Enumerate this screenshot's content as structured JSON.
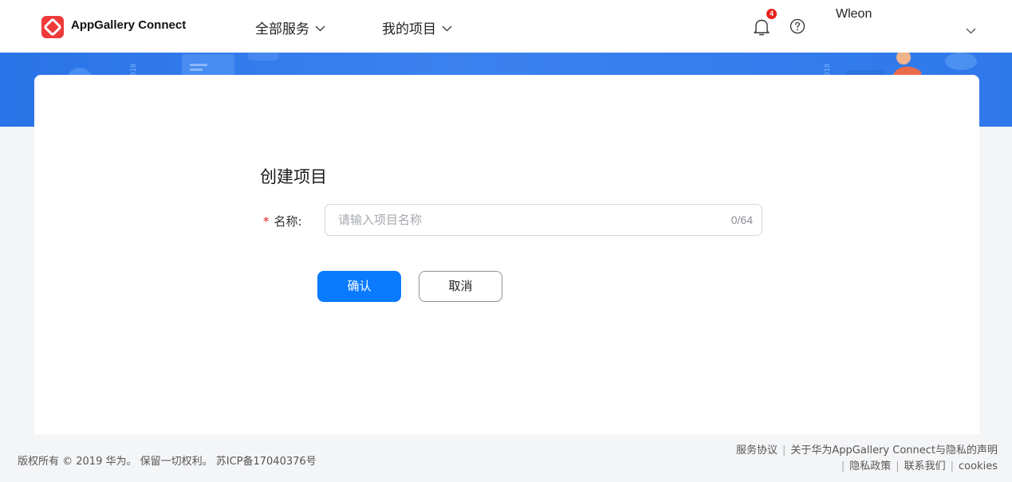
{
  "header": {
    "app_name": "AppGallery Connect",
    "nav": {
      "all_services": "全部服务",
      "my_projects": "我的项目"
    },
    "notification_count": "4",
    "user_name": "Wleon"
  },
  "form": {
    "title": "创建项目",
    "name_label": "名称:",
    "required_mark": "*",
    "name_placeholder": "请输入项目名称",
    "name_value": "",
    "char_counter": "0/64",
    "confirm_label": "确认",
    "cancel_label": "取消"
  },
  "footer": {
    "copyright": "版权所有 © 2019 华为。 保留一切权利。 苏ICP备17040376号",
    "links_row1": [
      "服务协议",
      "关于华为AppGallery Connect与隐私的声明"
    ],
    "links_row2": [
      "隐私政策",
      "联系我们",
      "cookies"
    ]
  },
  "colors": {
    "brand_red": "#ef3a3a",
    "primary_blue": "#0a7bff",
    "banner_blue": "#2f78eb",
    "badge_red": "#e8211d"
  },
  "icons": {
    "logo": "appgallery-logo-icon",
    "notification": "bell-icon",
    "help": "help-circle-icon",
    "dropdown": "chevron-down-icon"
  }
}
